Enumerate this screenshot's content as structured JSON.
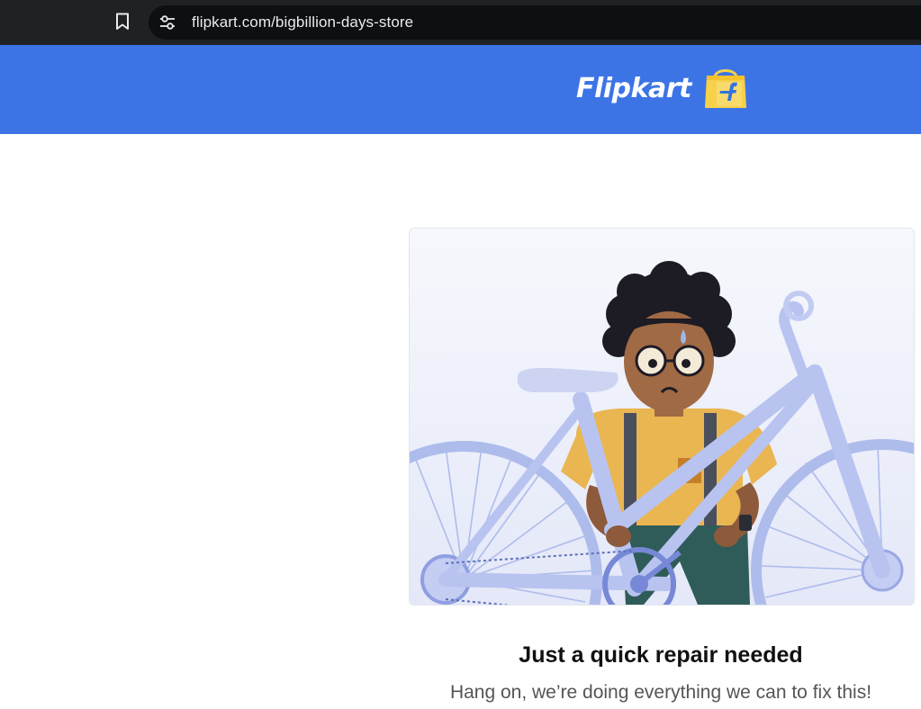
{
  "browser": {
    "url": "flipkart.com/bigbillion-days-store"
  },
  "header": {
    "brand": "Flipkart",
    "background_color": "#3c74e6",
    "logo_icon": "flipkart-shopping-bag-icon"
  },
  "error": {
    "illustration": "person-holding-broken-bicycle-illustration",
    "title": "Just a quick repair needed",
    "subtitle": "Hang on, we’re doing everything we can to fix this!"
  }
}
